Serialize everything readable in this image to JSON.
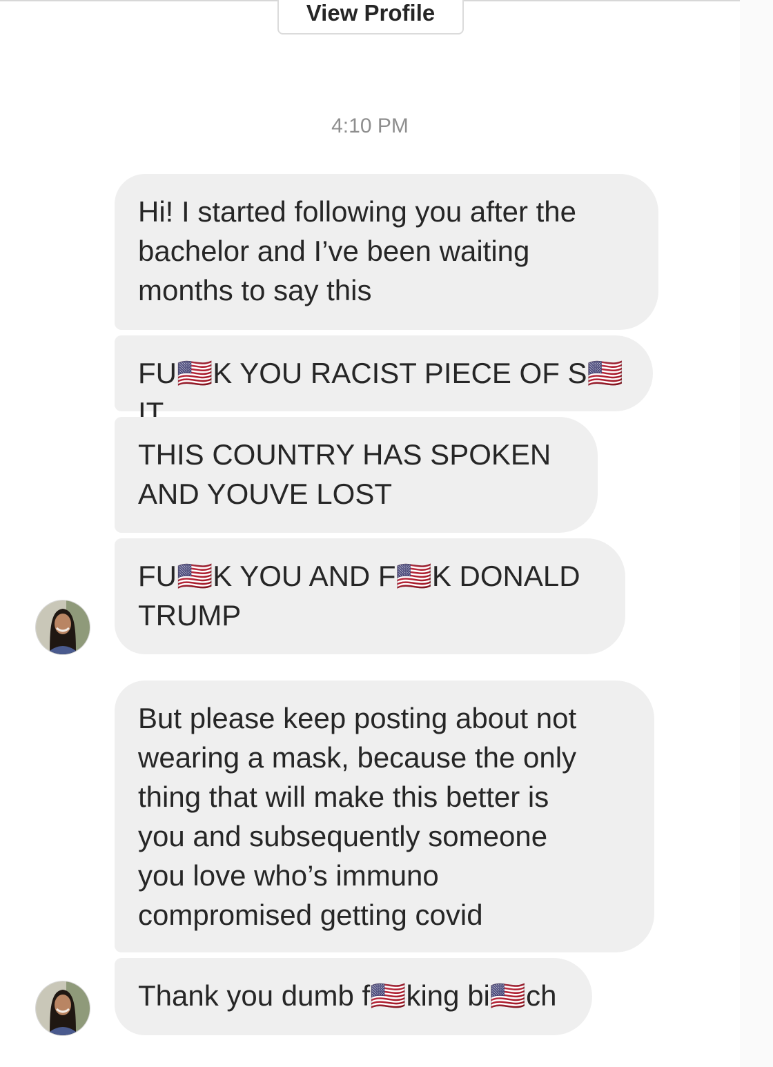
{
  "header": {
    "view_profile_label": "View Profile"
  },
  "thread": {
    "timestamp": "4:10 PM",
    "messages": [
      {
        "text": "Hi! I started following you after the\nbachelor and I’ve been waiting\nmonths to say this"
      },
      {
        "text": "FU🇺🇸K YOU RACIST PIECE OF S🇺🇸IT"
      },
      {
        "text": "THIS COUNTRY HAS SPOKEN\nAND YOUVE LOST"
      },
      {
        "text": "FU🇺🇸K YOU AND F🇺🇸K DONALD\nTRUMP"
      },
      {
        "text": "But please keep posting about not\nwearing a mask, because the only\nthing that will make this better is\nyou and subsequently someone\nyou love who’s immuno\ncompromised getting covid"
      },
      {
        "text": "Thank you dumb f🇺🇸king bi🇺🇸ch"
      }
    ]
  },
  "colors": {
    "bubble_bg": "#efefef",
    "text": "#262626",
    "timestamp": "#8e8e8e",
    "button_border": "#dbdbdb"
  }
}
